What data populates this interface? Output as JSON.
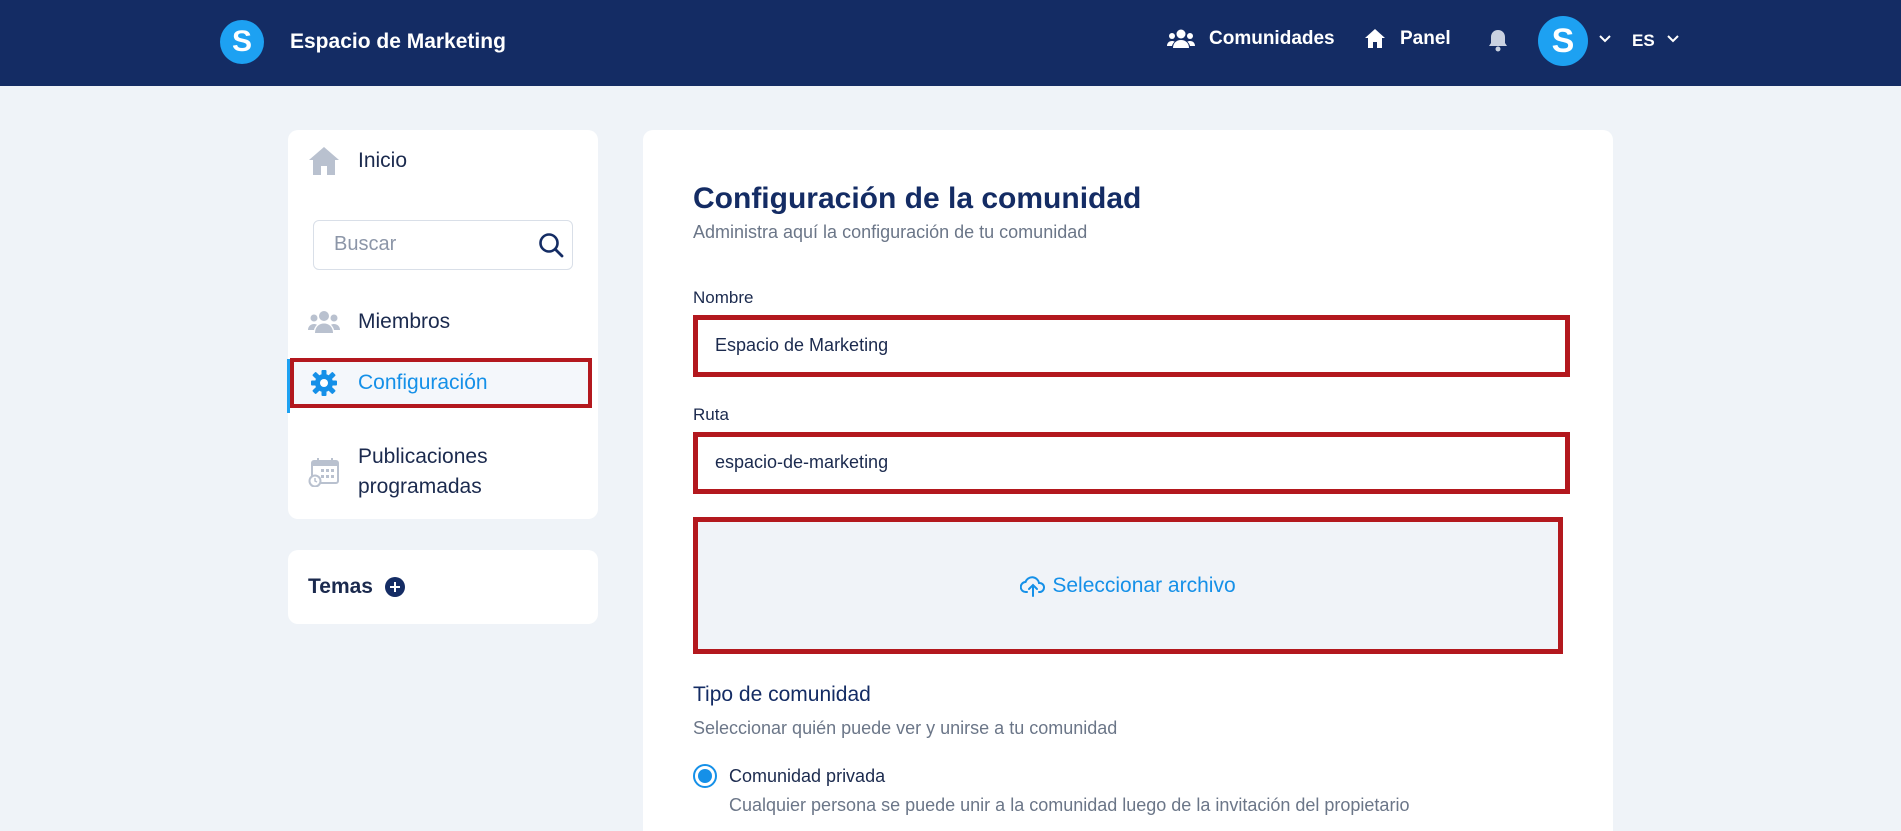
{
  "header": {
    "logo_letter": "S",
    "app_title": "Espacio de Marketing",
    "nav_communities": "Comunidades",
    "nav_panel": "Panel",
    "avatar_letter": "S",
    "language": "ES"
  },
  "sidebar": {
    "home_label": "Inicio",
    "search_placeholder": "Buscar",
    "members_label": "Miembros",
    "settings_label": "Configuración",
    "scheduled_line1": "Publicaciones",
    "scheduled_line2": "programadas",
    "topics_title": "Temas"
  },
  "main": {
    "title": "Configuración de la comunidad",
    "subtitle": "Administra aquí la configuración de tu comunidad",
    "name_label": "Nombre",
    "name_value": "Espacio de Marketing",
    "path_label": "Ruta",
    "path_value": "espacio-de-marketing",
    "upload_label": "Seleccionar archivo",
    "type_title": "Tipo de comunidad",
    "type_subtitle": "Seleccionar quién puede ver y unirse a tu comunidad",
    "private_title": "Comunidad privada",
    "private_desc": "Cualquier persona se puede unir a la comunidad luego de la invitación del propietario"
  },
  "colors": {
    "header_bg": "#142c64",
    "accent": "#1590e8",
    "highlight_border": "#b3181e"
  }
}
